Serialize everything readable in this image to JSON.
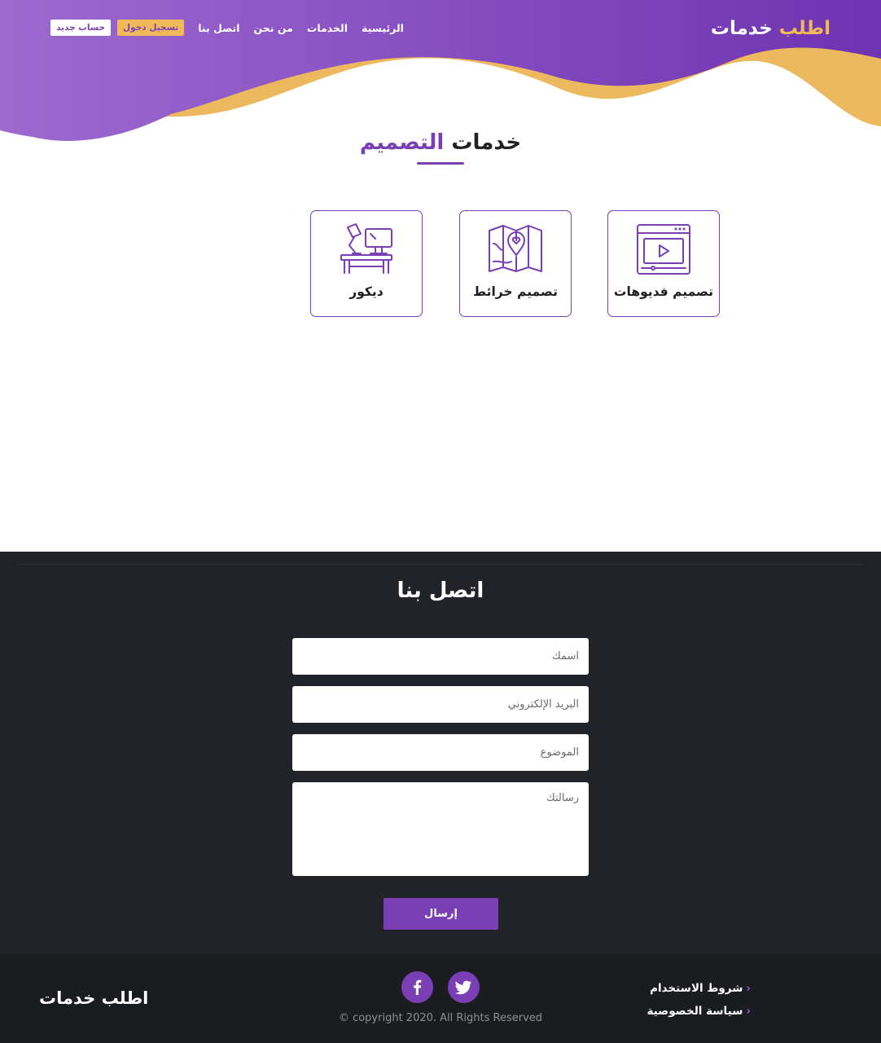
{
  "colors": {
    "primary": "#7a3fb5",
    "accent": "#f0b95a",
    "contact_bg": "#212328",
    "footer_bg": "#1b1c20"
  },
  "header": {
    "brand_part1": "اطلب",
    "brand_part2": "خدمات",
    "nav": {
      "home": "الرئيسية",
      "services": "الخدمات",
      "about": "من نحن",
      "contact": "اتصل بنا"
    },
    "login_label": "تسجيل دخول",
    "register_label": "حساب جديد"
  },
  "services_section": {
    "title_part1": "خدمات",
    "title_part2": "التصميم",
    "cards": [
      {
        "label": "تصميم فديوهات",
        "icon": "video-player-icon"
      },
      {
        "label": "تصميم خرائط",
        "icon": "map-icon"
      },
      {
        "label": "ديكور",
        "icon": "desk-lamp-icon"
      }
    ]
  },
  "contact": {
    "title": "اتصل بنا",
    "name_placeholder": "اسمك",
    "email_placeholder": "البريد الإلكتروني",
    "subject_placeholder": "الموضوع",
    "message_placeholder": "رسالتك",
    "send_label": "إرسال"
  },
  "footer": {
    "brand": "اطلب خدمات",
    "copyright": "© copyright 2020. All Rights Reserved",
    "links": [
      "شروط الاستخدام",
      "سياسة الخصوصية"
    ],
    "social": [
      "facebook-icon",
      "twitter-icon"
    ]
  }
}
